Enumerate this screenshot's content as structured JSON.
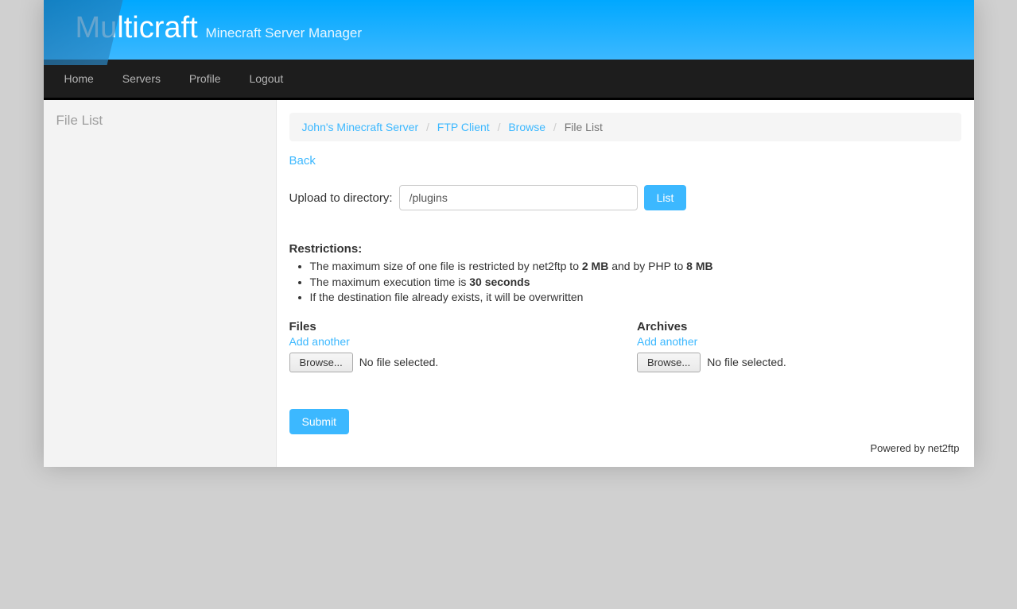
{
  "banner": {
    "title": "Multicraft",
    "subtitle": "Minecraft Server Manager"
  },
  "nav": {
    "home": "Home",
    "servers": "Servers",
    "profile": "Profile",
    "logout": "Logout"
  },
  "sidebar": {
    "title": "File List"
  },
  "breadcrumb": {
    "server": "John's Minecraft Server",
    "ftp": "FTP Client",
    "browse": "Browse",
    "current": "File List"
  },
  "main": {
    "back": "Back",
    "upload_label": "Upload to directory:",
    "upload_dir": "/plugins",
    "list_btn": "List",
    "restrictions_title": "Restrictions:",
    "restriction1_pre": "The maximum size of one file is restricted by net2ftp to ",
    "restriction1_v1": "2 MB",
    "restriction1_mid": " and by PHP to ",
    "restriction1_v2": "8 MB",
    "restriction2_pre": "The maximum execution time is ",
    "restriction2_v": "30 seconds",
    "restriction3": "If the destination file already exists, it will be overwritten",
    "files_title": "Files",
    "archives_title": "Archives",
    "add_another": "Add another",
    "browse_btn": "Browse...",
    "no_file": "No file selected.",
    "submit": "Submit",
    "powered": "Powered by net2ftp"
  }
}
